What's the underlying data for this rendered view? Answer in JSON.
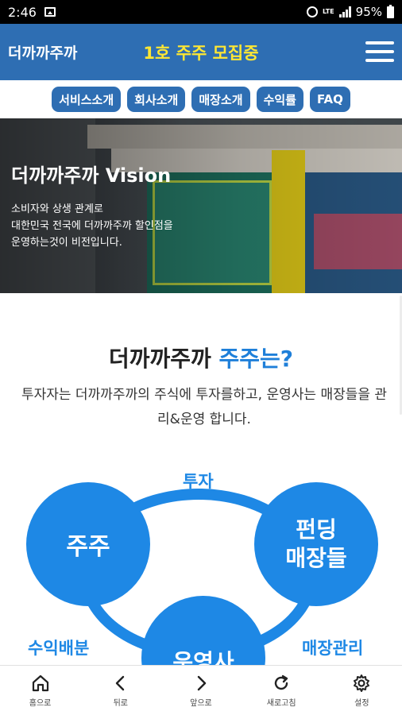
{
  "status_bar": {
    "time": "2:46",
    "battery": "95%",
    "network": "LTE"
  },
  "header": {
    "brand": "더까까주까",
    "recruit": "1호 주주 모집중"
  },
  "nav": {
    "items": [
      {
        "label": "서비스소개"
      },
      {
        "label": "회사소개"
      },
      {
        "label": "매장소개"
      },
      {
        "label": "수익률"
      },
      {
        "label": "FAQ"
      }
    ]
  },
  "hero": {
    "title": "더까까주까 Vision",
    "desc_line1": "소비자와 상생 관계로",
    "desc_line2": "대한민국 전국에 더까까주까 할인점을",
    "desc_line3": "운영하는것이 비전입니다."
  },
  "section": {
    "title_main": "더까까주까 ",
    "title_accent": "주주는?",
    "desc": "투자자는 더까까주까의 주식에 투자를하고, 운영사는 매장들을 관리&운영 합니다."
  },
  "diagram": {
    "shareholder": "주주",
    "store_line1": "펀딩",
    "store_line2": "매장들",
    "operator": "운영사",
    "invest": "투자",
    "profit_share": "수익배분",
    "store_manage": "매장관리"
  },
  "bottom_nav": {
    "home": "홈으로",
    "back": "뒤로",
    "forward": "앞으로",
    "refresh": "새로고침",
    "settings": "설정"
  },
  "colors": {
    "header_bg": "#2e6eb3",
    "recruit_text": "#ffe733",
    "accent_blue": "#1e88e5"
  }
}
